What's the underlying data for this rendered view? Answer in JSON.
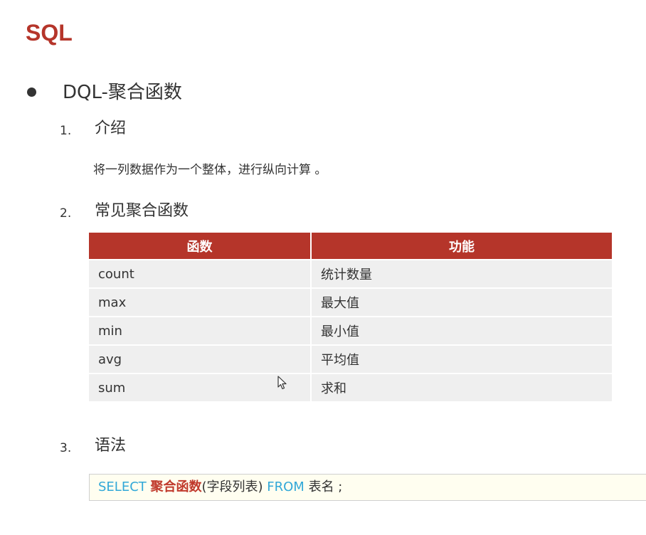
{
  "title": "SQL",
  "section": {
    "title": "DQL-聚合函数"
  },
  "items": [
    {
      "number": "1.",
      "heading": "介绍",
      "description": "将一列数据作为一个整体，进行纵向计算 。"
    },
    {
      "number": "2.",
      "heading": "常见聚合函数"
    },
    {
      "number": "3.",
      "heading": "语法"
    }
  ],
  "table": {
    "headers": [
      "函数",
      "功能"
    ],
    "rows": [
      [
        "count",
        "统计数量"
      ],
      [
        "max",
        "最大值"
      ],
      [
        "min",
        "最小值"
      ],
      [
        "avg",
        "平均值"
      ],
      [
        "sum",
        "求和"
      ]
    ]
  },
  "syntax": {
    "select": "SELECT",
    "func": "聚合函数",
    "args": "(字段列表)",
    "from": "FROM",
    "table": "表名 ;"
  },
  "colors": {
    "accent": "#b5352a",
    "keyword": "#31a8d8",
    "row_bg": "#efefef",
    "code_bg": "#fffef0"
  }
}
